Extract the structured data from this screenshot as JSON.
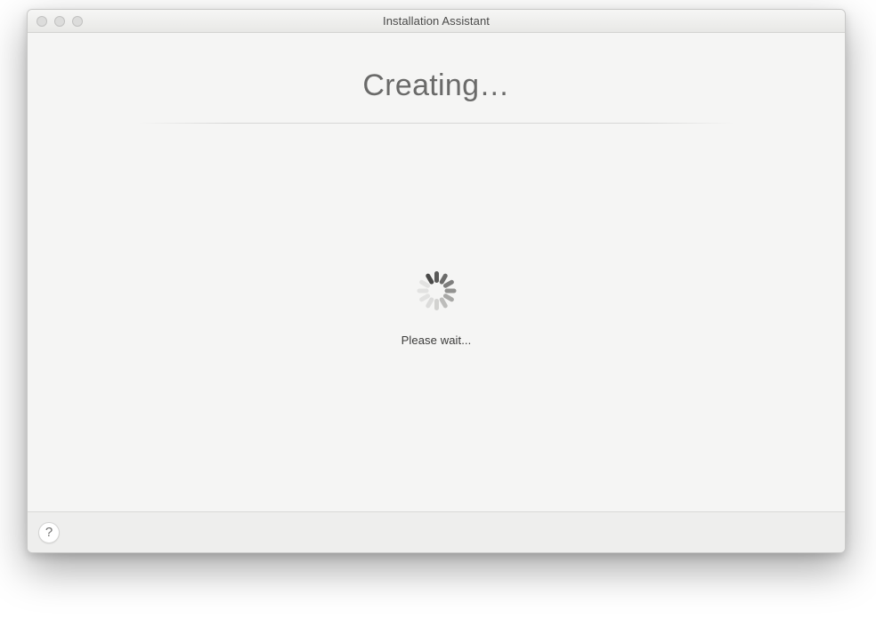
{
  "window": {
    "title": "Installation Assistant"
  },
  "heading": "Creating…",
  "status_text": "Please wait...",
  "help_symbol": "?"
}
